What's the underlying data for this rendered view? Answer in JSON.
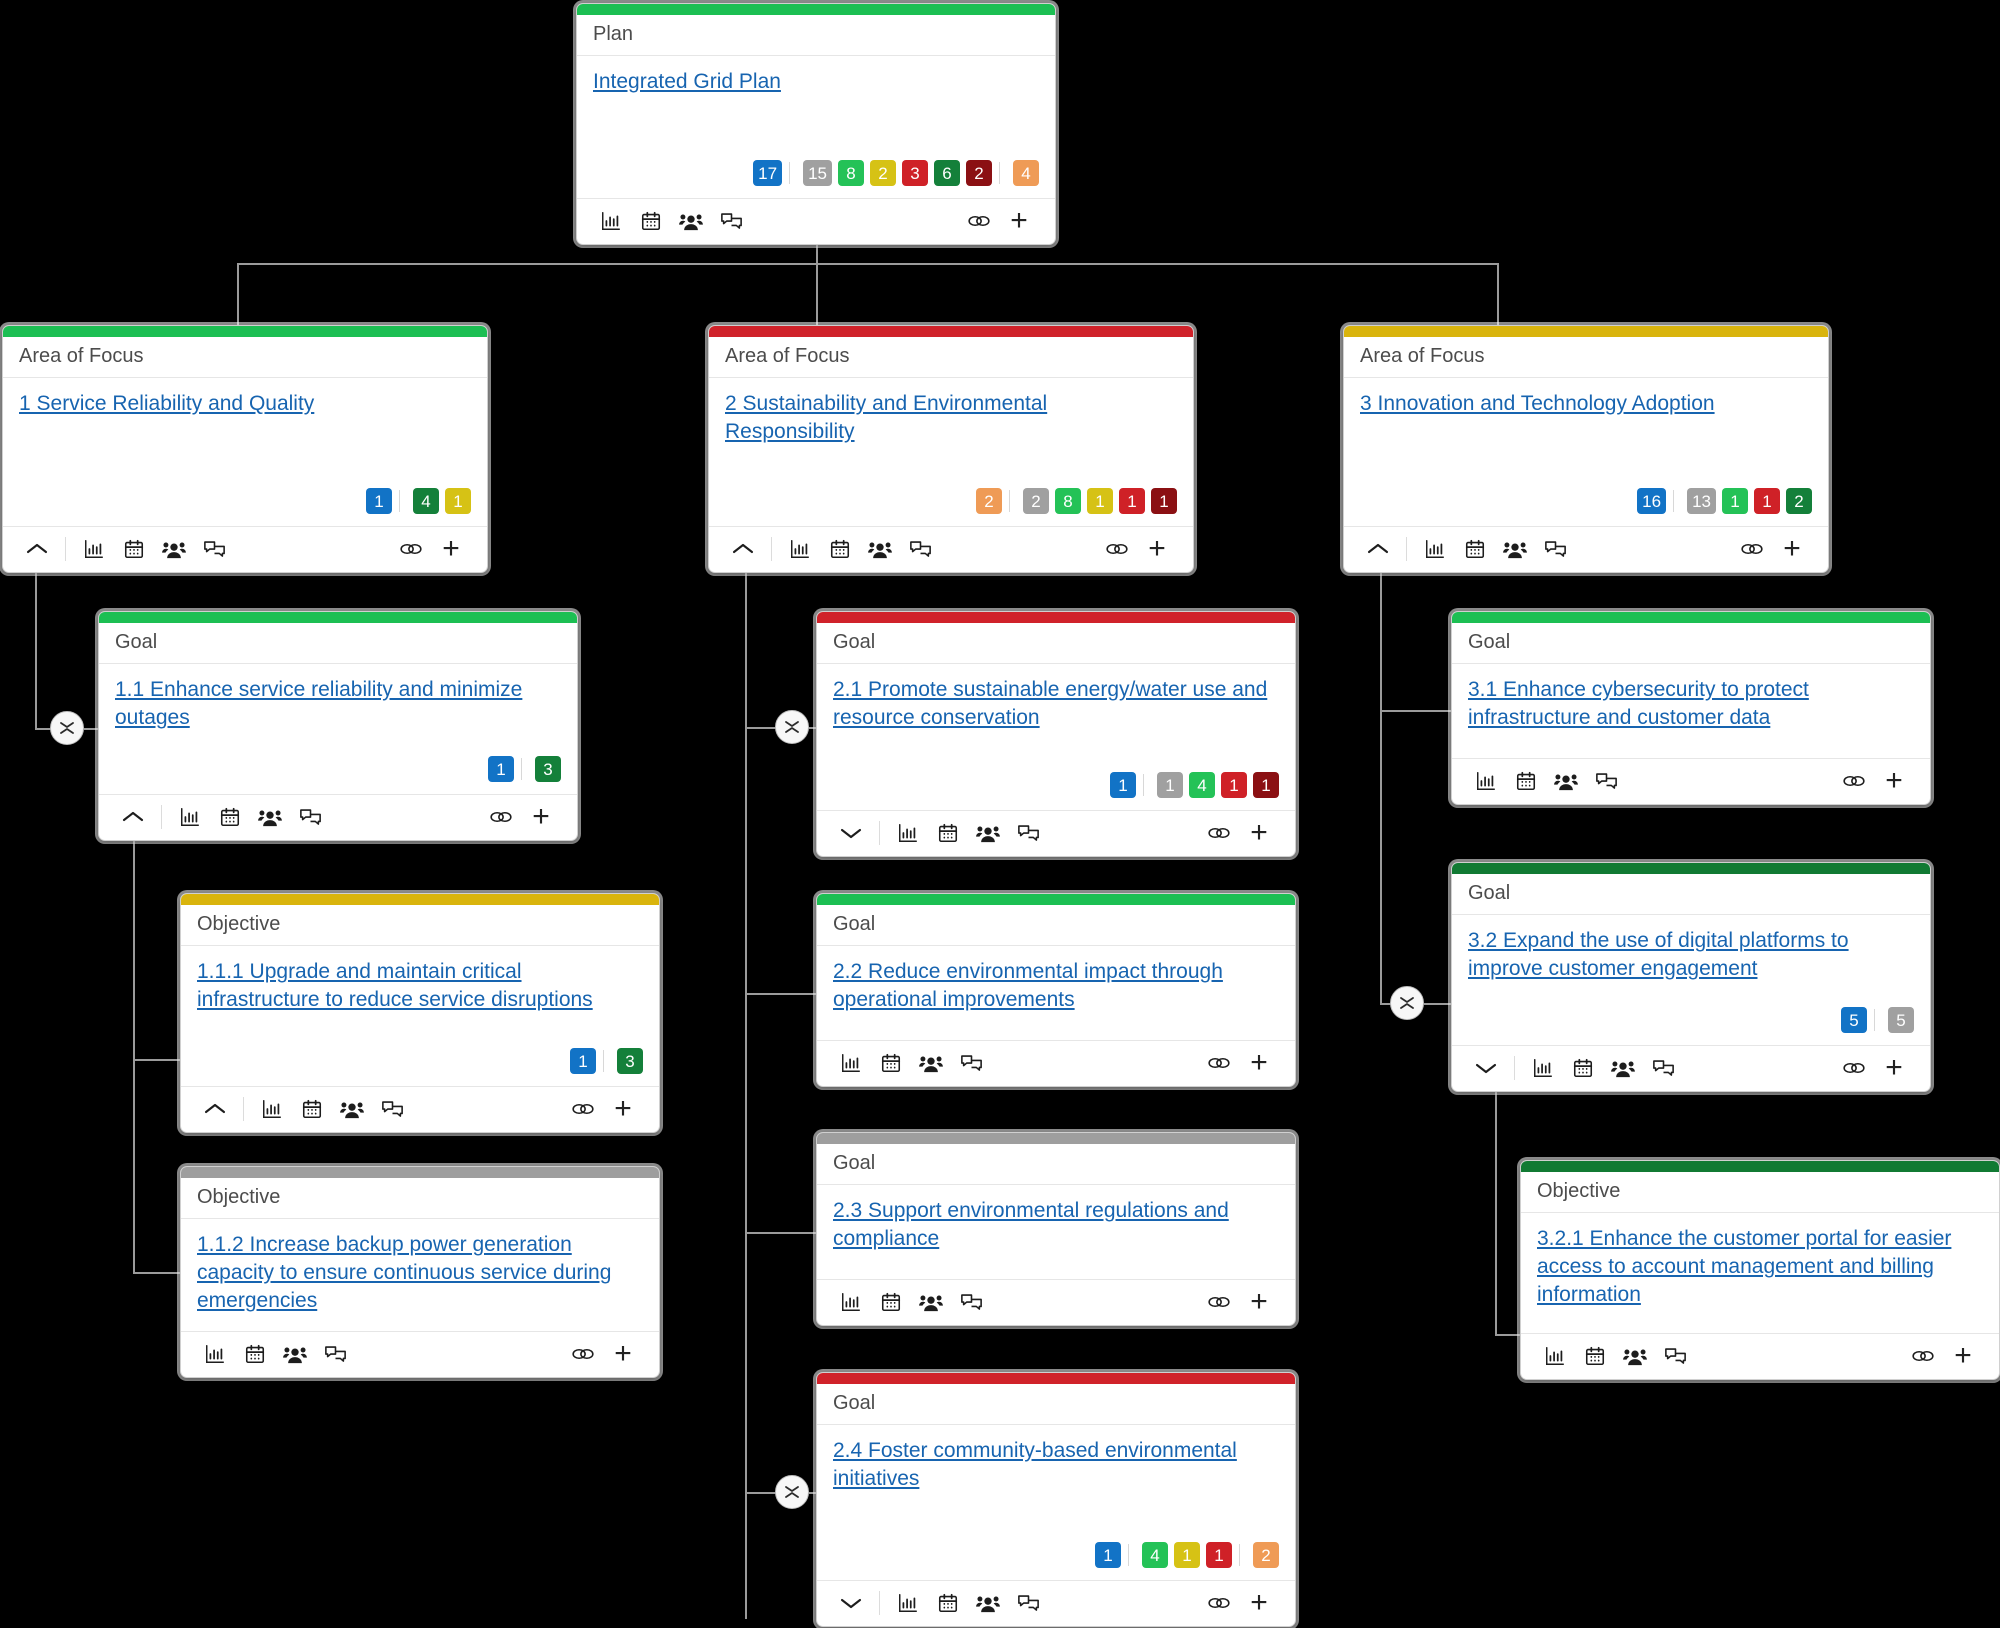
{
  "icons": {
    "chart": "bar-chart-icon",
    "calendar": "calendar-icon",
    "people": "people-icon",
    "chat": "chat-icon",
    "link": "link-icon",
    "plus": "plus-icon",
    "chevron_up": "chevron-up-icon",
    "chevron_down": "chevron-down-icon",
    "collapse_toggle": "collapse-expand-icon"
  },
  "palette": {
    "stripe_green": "#1cbf53",
    "stripe_red": "#d0222a",
    "stripe_gold": "#d9b40d",
    "stripe_darkgreen": "#117a33",
    "stripe_gray": "#9e9e9e",
    "badge_blue": "#1273c6",
    "badge_gray": "#a0a0a0",
    "badge_green": "#24c257",
    "badge_yellow": "#d6c215",
    "badge_red": "#cf2127",
    "badge_dark_green": "#14803a",
    "badge_dark_red": "#8b1013",
    "badge_orange": "#ef9b56",
    "title_link": "#1764b0"
  },
  "nodes": {
    "plan": {
      "type_label": "Plan",
      "title": "Integrated Grid Plan",
      "stripe": "green",
      "badges": [
        {
          "value": "17",
          "color": "blue"
        },
        {
          "sep": true
        },
        {
          "value": "15",
          "color": "gray"
        },
        {
          "value": "8",
          "color": "green"
        },
        {
          "value": "2",
          "color": "yellow"
        },
        {
          "value": "3",
          "color": "red"
        },
        {
          "value": "6",
          "color": "dgreen"
        },
        {
          "value": "2",
          "color": "dred"
        },
        {
          "sep": true
        },
        {
          "value": "4",
          "color": "orange"
        }
      ],
      "chevron": null
    },
    "aof1": {
      "type_label": "Area of Focus",
      "title": "1 Service Reliability and Quality",
      "stripe": "green",
      "badges": [
        {
          "value": "1",
          "color": "blue"
        },
        {
          "sep": true
        },
        {
          "value": "4",
          "color": "dgreen"
        },
        {
          "value": "1",
          "color": "yellow"
        }
      ],
      "chevron": "up"
    },
    "aof2": {
      "type_label": "Area of Focus",
      "title": "2 Sustainability and Environmental Responsibility",
      "stripe": "red",
      "badges": [
        {
          "value": "2",
          "color": "orange"
        },
        {
          "sep": true
        },
        {
          "value": "2",
          "color": "gray"
        },
        {
          "value": "8",
          "color": "green"
        },
        {
          "value": "1",
          "color": "yellow"
        },
        {
          "value": "1",
          "color": "red"
        },
        {
          "value": "1",
          "color": "dred"
        }
      ],
      "chevron": "up"
    },
    "aof3": {
      "type_label": "Area of Focus",
      "title": "3 Innovation and Technology Adoption",
      "stripe": "gold",
      "badges": [
        {
          "value": "16",
          "color": "blue"
        },
        {
          "sep": true
        },
        {
          "value": "13",
          "color": "gray"
        },
        {
          "value": "1",
          "color": "green"
        },
        {
          "value": "1",
          "color": "red"
        },
        {
          "value": "2",
          "color": "dgreen"
        }
      ],
      "chevron": "up"
    },
    "goal11": {
      "type_label": "Goal",
      "title": "1.1 Enhance service reliability and minimize outages",
      "stripe": "green",
      "badges": [
        {
          "value": "1",
          "color": "blue"
        },
        {
          "sep": true
        },
        {
          "value": "3",
          "color": "dgreen"
        }
      ],
      "chevron": "up"
    },
    "obj111": {
      "type_label": "Objective",
      "title": "1.1.1 Upgrade and maintain critical infrastructure to reduce service disruptions",
      "stripe": "gold",
      "badges": [
        {
          "value": "1",
          "color": "blue"
        },
        {
          "sep": true
        },
        {
          "value": "3",
          "color": "dgreen"
        }
      ],
      "chevron": "up"
    },
    "obj112": {
      "type_label": "Objective",
      "title": "1.1.2 Increase backup power generation capacity to ensure continuous service during emergencies",
      "stripe": "gray",
      "badges": [],
      "chevron": null
    },
    "goal21": {
      "type_label": "Goal",
      "title": "2.1 Promote sustainable energy/water use and resource conservation",
      "stripe": "red",
      "badges": [
        {
          "value": "1",
          "color": "blue"
        },
        {
          "sep": true
        },
        {
          "value": "1",
          "color": "gray"
        },
        {
          "value": "4",
          "color": "green"
        },
        {
          "value": "1",
          "color": "red"
        },
        {
          "value": "1",
          "color": "dred"
        }
      ],
      "chevron": "down"
    },
    "goal22": {
      "type_label": "Goal",
      "title": "2.2 Reduce environmental impact through operational improvements",
      "stripe": "green",
      "badges": [],
      "chevron": null
    },
    "goal23": {
      "type_label": "Goal",
      "title": "2.3 Support environmental regulations and compliance",
      "stripe": "gray",
      "badges": [],
      "chevron": null
    },
    "goal24": {
      "type_label": "Goal",
      "title": "2.4 Foster community-based environmental initiatives",
      "stripe": "red",
      "badges": [
        {
          "value": "1",
          "color": "blue"
        },
        {
          "sep": true
        },
        {
          "value": "4",
          "color": "green"
        },
        {
          "value": "1",
          "color": "yellow"
        },
        {
          "value": "1",
          "color": "red"
        },
        {
          "sep": true
        },
        {
          "value": "2",
          "color": "orange"
        }
      ],
      "chevron": "down"
    },
    "goal31": {
      "type_label": "Goal",
      "title": "3.1 Enhance cybersecurity to protect infrastructure and customer data",
      "stripe": "green",
      "badges": [],
      "chevron": null
    },
    "goal32": {
      "type_label": "Goal",
      "title": "3.2 Expand the use of digital platforms to improve customer engagement",
      "stripe": "darkgreen",
      "badges": [
        {
          "value": "5",
          "color": "blue"
        },
        {
          "sep": true
        },
        {
          "value": "5",
          "color": "gray"
        }
      ],
      "chevron": "down"
    },
    "obj321": {
      "type_label": "Objective",
      "title": "3.2.1 Enhance the customer portal for easier access to account management and billing information",
      "stripe": "darkgreen",
      "badges": [],
      "chevron": null
    }
  }
}
